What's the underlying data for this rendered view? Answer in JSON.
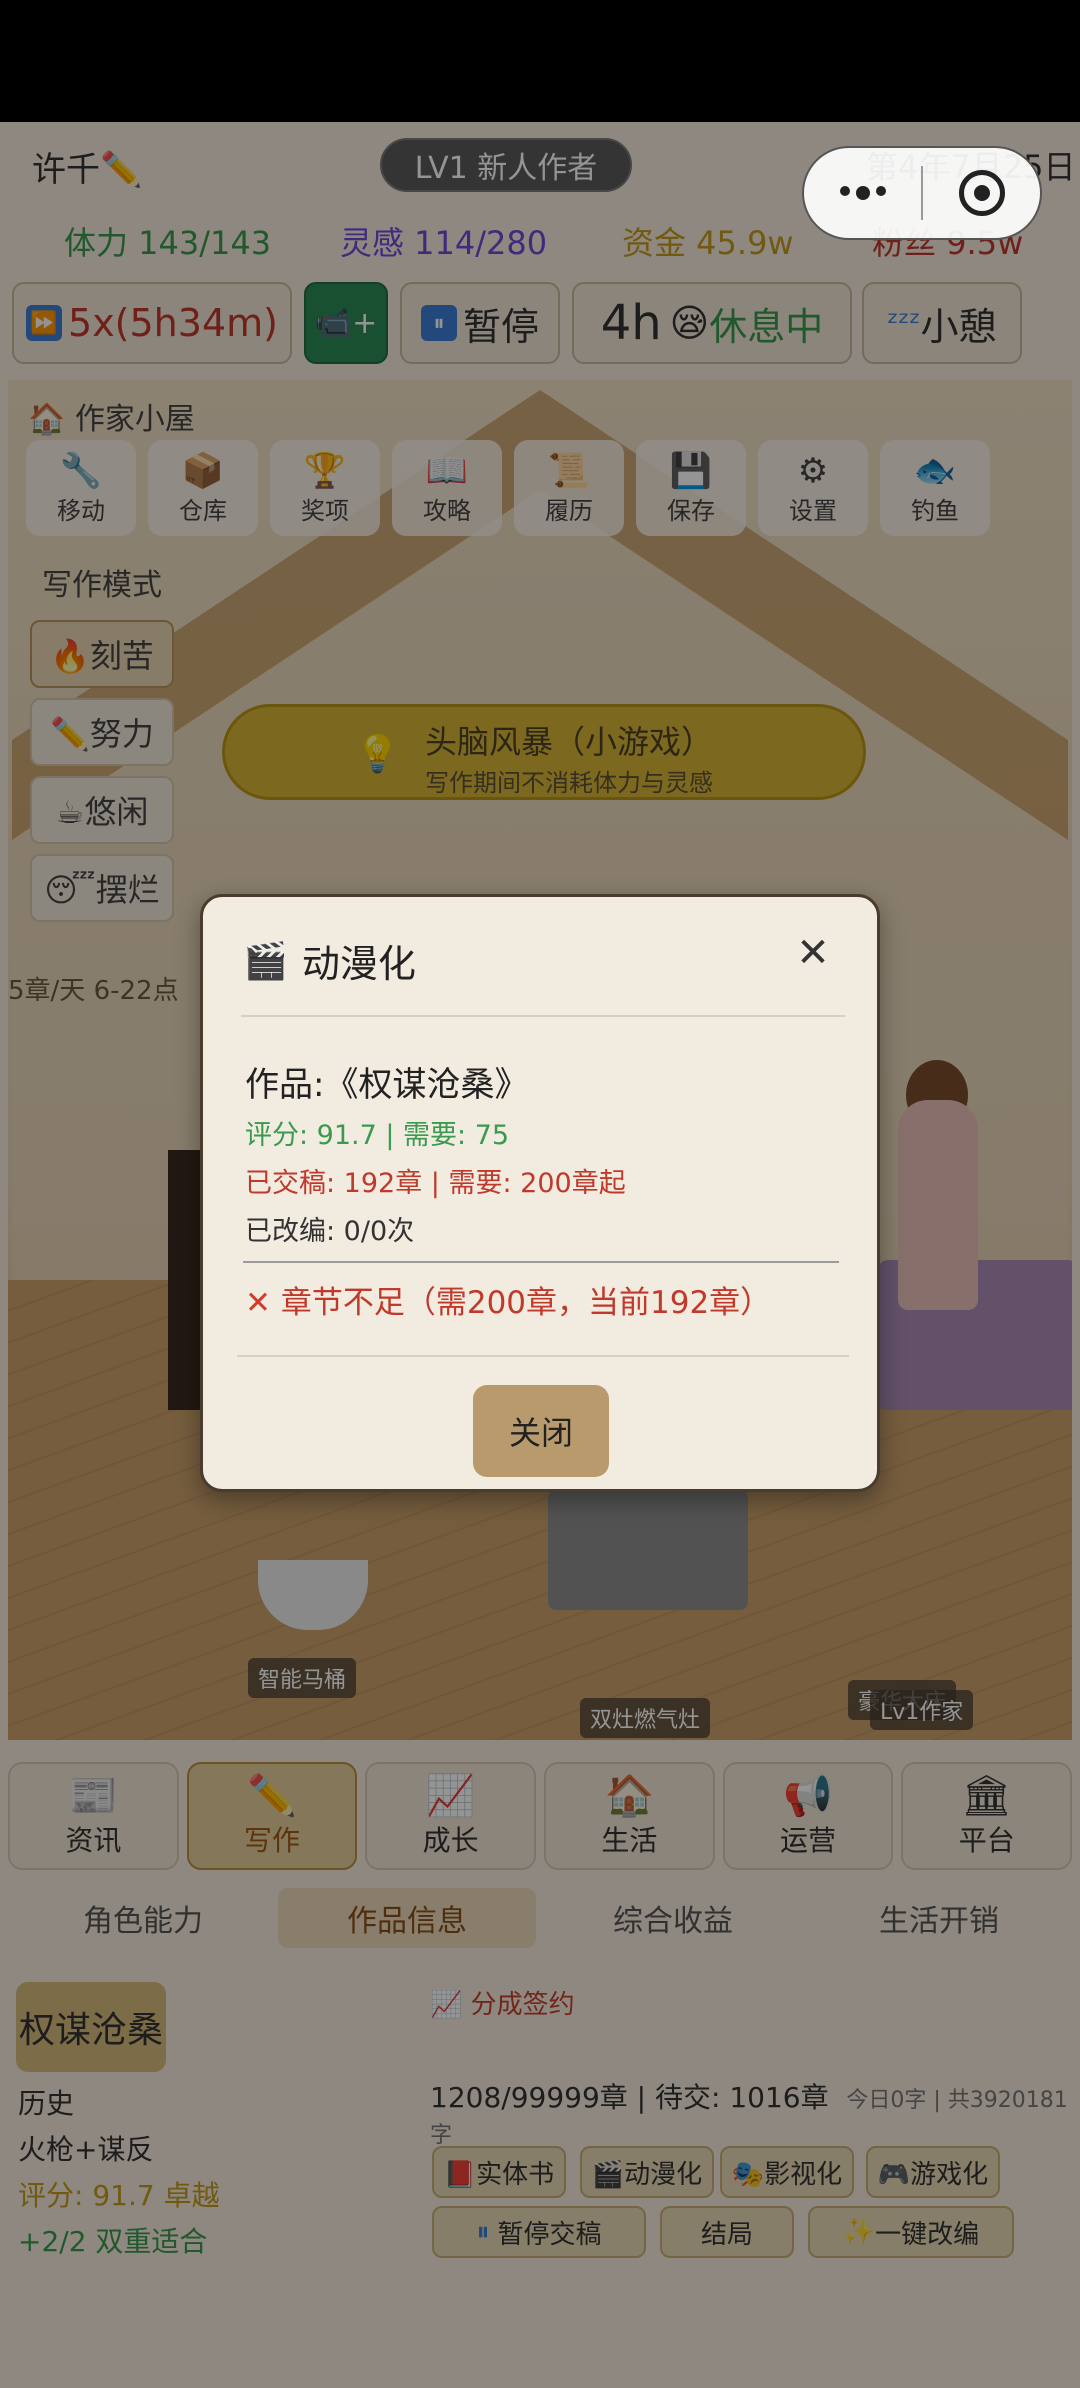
{
  "header": {
    "name": "许千",
    "level": "LV1 新人作者",
    "date": "第4年7月25日"
  },
  "stats": {
    "stamina": "体力 143/143",
    "inspiration": "灵感 114/280",
    "money": "资金 45.9w",
    "fans": "粉丝 9.5w"
  },
  "controls": {
    "speed": "5x(5h34m)",
    "pause": "暂停",
    "rest_hours": "4h",
    "rest_status": "休息中",
    "nap": "小憩"
  },
  "room": {
    "title": "作家小屋",
    "tools": [
      {
        "icon": "wrench-icon",
        "glyph": "🔧",
        "label": "移动"
      },
      {
        "icon": "box-icon",
        "glyph": "📦",
        "label": "仓库"
      },
      {
        "icon": "trophy-icon",
        "glyph": "🏆",
        "label": "奖项"
      },
      {
        "icon": "book-icon",
        "glyph": "📖",
        "label": "攻略"
      },
      {
        "icon": "resume-icon",
        "glyph": "📜",
        "label": "履历"
      },
      {
        "icon": "save-icon",
        "glyph": "💾",
        "label": "保存"
      },
      {
        "icon": "gear-icon",
        "glyph": "⚙",
        "label": "设置"
      },
      {
        "icon": "fish-icon",
        "glyph": "🐟",
        "label": "钓鱼"
      }
    ],
    "modes_title": "写作模式",
    "modes": [
      "🔥刻苦",
      "✏️努力",
      "☕悠闲",
      "😴摆烂"
    ],
    "pace": "5章/天 6-22点",
    "brainstorm_title": "头脑风暴（小游戏）",
    "brainstorm_sub": "写作期间不消耗体力与灵感",
    "labels": {
      "toilet": "智能马桶",
      "stove": "双灶燃气灶",
      "bed": "豪华大床",
      "author": "Lv1作家"
    }
  },
  "nav": [
    {
      "icon": "news-icon",
      "glyph": "📰",
      "label": "资讯"
    },
    {
      "icon": "pencil-icon",
      "glyph": "✏️",
      "label": "写作"
    },
    {
      "icon": "growth-chart-icon",
      "glyph": "📈",
      "label": "成长"
    },
    {
      "icon": "house-icon",
      "glyph": "🏠",
      "label": "生活"
    },
    {
      "icon": "megaphone-icon",
      "glyph": "📢",
      "label": "运营"
    },
    {
      "icon": "platform-icon",
      "glyph": "🏛",
      "label": "平台"
    }
  ],
  "subtabs": [
    "角色能力",
    "作品信息",
    "综合收益",
    "生活开销"
  ],
  "work": {
    "title": "权谋沧桑",
    "genre": "历史",
    "tags": "火枪+谋反",
    "score": "评分: 91.7 卓越",
    "fit": "+2/2 双重适合",
    "sign": "分成签约",
    "progress": "1208/99999章 | 待交: 1016章",
    "today": "今日0字 | 共3920181字",
    "actions": [
      "📕实体书",
      "🎬动漫化",
      "🎭影视化",
      "🎮游戏化"
    ],
    "pause_submit": "暂停交稿",
    "ending": "结局",
    "oneclick": "一键改编"
  },
  "modal": {
    "title": "动漫化",
    "work": "作品:《权谋沧桑》",
    "score": "评分: 91.7 | 需要: 75",
    "chapters": "已交稿: 192章 | 需要: 200章起",
    "adapted": "已改编: 0/0次",
    "error": "章节不足（需200章，当前192章）",
    "close": "关闭"
  },
  "colors": {
    "green": "#3a9a4f",
    "purple": "#6a4bd4",
    "gold": "#c49a1d",
    "red": "#c0392b"
  }
}
